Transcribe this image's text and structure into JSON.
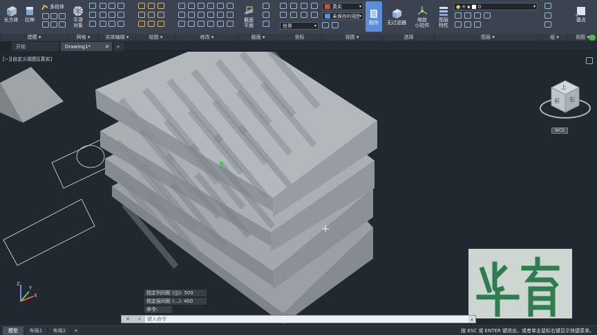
{
  "ribbon": {
    "big_buttons": [
      {
        "label": "长方体"
      },
      {
        "label": "拉伸"
      },
      {
        "label": "多段体"
      },
      {
        "label": "平滑\n对象"
      },
      {
        "label": "截面\n平面"
      },
      {
        "label": "删除"
      },
      {
        "label": "无过滤器"
      },
      {
        "label": "缩放\n小控件"
      },
      {
        "label": "图层\n特性"
      },
      {
        "label": "基点"
      }
    ],
    "groups": [
      {
        "label": "建模 ▾"
      },
      {
        "label": "网格 ▾"
      },
      {
        "label": "实体编辑 ▾"
      },
      {
        "label": "绘图 ▾"
      },
      {
        "label": "修改 ▾"
      },
      {
        "label": "截面 ▾"
      },
      {
        "label": "坐标"
      },
      {
        "label": "视图 ▾"
      },
      {
        "label": "选择"
      },
      {
        "label": "图层 ▾"
      },
      {
        "label": "组 ▾"
      },
      {
        "label": "视图 ▾"
      }
    ],
    "visual_style": "真实",
    "saved_view": "未保存的视图",
    "ucs": "世界",
    "layer": "0"
  },
  "tabs": [
    {
      "label": "开始"
    },
    {
      "label": "Drawing1*"
    }
  ],
  "viewport": {
    "label": "[−][自定义视图][真实]",
    "viewcube": {
      "top": "上",
      "front": "前",
      "right": "右",
      "wcs": "WCS"
    }
  },
  "command": {
    "history": [
      "指定列间距 (|||): 500",
      "指定层间距 (...): 400",
      "命令:"
    ],
    "placeholder": "键入命令"
  },
  "layout_tabs": [
    {
      "label": "模型"
    },
    {
      "label": "布局1"
    },
    {
      "label": "布局2"
    }
  ],
  "status_hint": "按 ESC 或 ENTER 键退出，或者单击鼠标右键显示快捷菜单。",
  "colors": {
    "accent": "#5b8ed6",
    "solid": "#b0b5ba",
    "background": "#212830",
    "watermark": "#2e7d4f"
  }
}
